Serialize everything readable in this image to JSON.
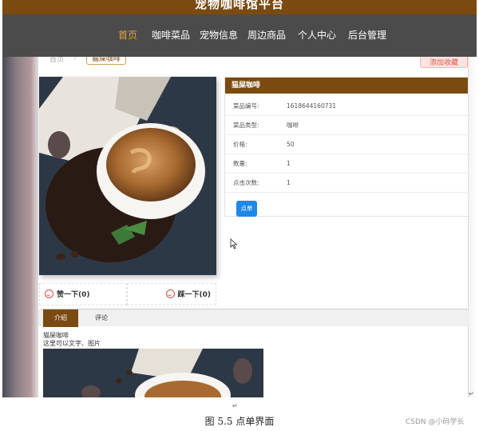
{
  "site": {
    "title": "宠物咖啡馆平台"
  },
  "nav": {
    "items": [
      "首页",
      "咖啡菜品",
      "宠物信息",
      "周边商品",
      "个人中心",
      "后台管理"
    ],
    "active": "首页",
    "active_color": "#e2a53b"
  },
  "breadcrumb": {
    "home": "首页",
    "separator": "/",
    "current": "猫屎咖啡"
  },
  "favorite_button": "添加收藏",
  "product": {
    "title": "猫屎咖啡",
    "fields": [
      {
        "label": "菜品编号:",
        "value": "1618644160731"
      },
      {
        "label": "菜品类型:",
        "value": "咖啡"
      },
      {
        "label": "价格:",
        "value": "50"
      },
      {
        "label": "数量:",
        "value": "1"
      },
      {
        "label": "点击次数:",
        "value": "1"
      }
    ],
    "order_button": "点单"
  },
  "votes": {
    "like": "赞一下(0)",
    "dislike": "踩一下(0)"
  },
  "tabs": {
    "intro": "介绍",
    "comments": "评论"
  },
  "intro": {
    "line1": "猫屎咖啡",
    "line2": "这里可以文字、图片"
  },
  "figure": {
    "caption": "图 5.5 点单界面",
    "watermark": "CSDN @小码学长",
    "mark": "↵"
  },
  "colors": {
    "brand_brown": "#7b4a10",
    "nav_bg": "#4b4b4b",
    "order_blue": "#1e88e5",
    "vote_red": "#e24a3e"
  }
}
